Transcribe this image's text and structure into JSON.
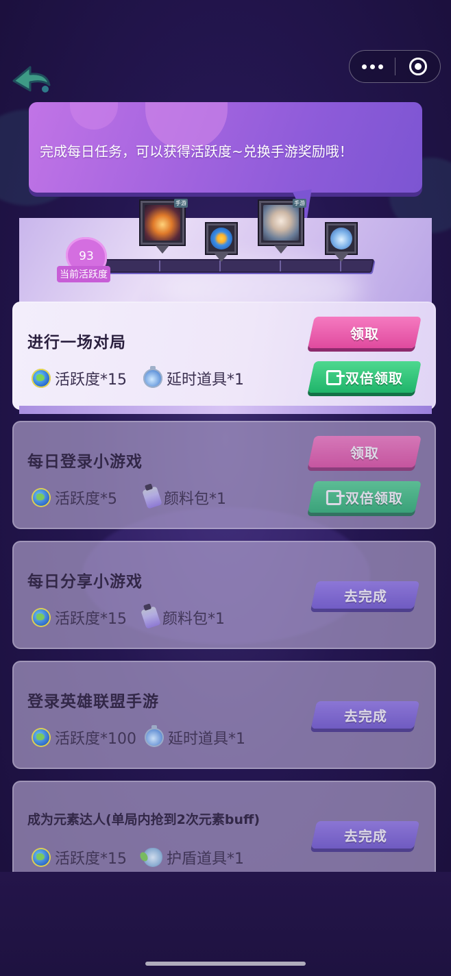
{
  "capsule": {
    "more_icon": "more-dots-icon",
    "close_icon": "target-close-icon"
  },
  "banner": {
    "text": "完成每日任务，可以获得活跃度~兑换手游奖励哦！"
  },
  "activity": {
    "value": "93",
    "label": "当前活跃度",
    "rewards": [
      {
        "name": "reward-1",
        "tag": "手游"
      },
      {
        "name": "reward-2",
        "tag": ""
      },
      {
        "name": "reward-3",
        "tag": "手游"
      },
      {
        "name": "reward-4",
        "tag": ""
      }
    ]
  },
  "tasks": [
    {
      "title": "进行一场对局",
      "rewards": [
        {
          "icon": "activity-globe-icon",
          "text": "活跃度*15"
        },
        {
          "icon": "time-prop-icon",
          "text": "延时道具*1"
        }
      ],
      "buttons": {
        "claim": "领取",
        "double": "双倍领取"
      }
    },
    {
      "title": "每日登录小游戏",
      "rewards": [
        {
          "icon": "activity-globe-icon",
          "text": "活跃度*5"
        },
        {
          "icon": "paint-pack-icon",
          "text": "颜料包*1"
        }
      ],
      "buttons": {
        "claim": "领取",
        "double": "双倍领取"
      }
    },
    {
      "title": "每日分享小游戏",
      "rewards": [
        {
          "icon": "activity-globe-icon",
          "text": "活跃度*15"
        },
        {
          "icon": "paint-pack-icon",
          "text": "颜料包*1"
        }
      ],
      "buttons": {
        "go": "去完成"
      }
    },
    {
      "title": "登录英雄联盟手游",
      "rewards": [
        {
          "icon": "activity-globe-icon",
          "text": "活跃度*100"
        },
        {
          "icon": "time-prop-icon",
          "text": "延时道具*1"
        }
      ],
      "buttons": {
        "go": "去完成"
      }
    },
    {
      "title": "成为元素达人(单局内抢到2次元素buff)",
      "rewards": [
        {
          "icon": "activity-globe-icon",
          "text": "活跃度*15"
        },
        {
          "icon": "shield-prop-icon",
          "text": "护盾道具*1"
        }
      ],
      "buttons": {
        "go": "去完成"
      }
    }
  ]
}
